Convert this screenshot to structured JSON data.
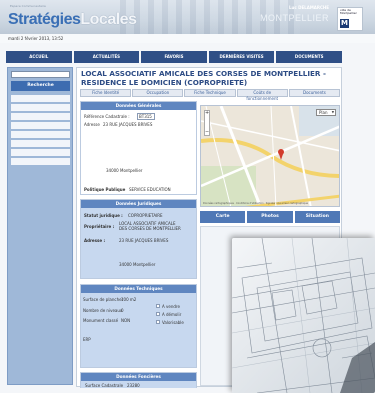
{
  "header": {
    "tiny_text": "Espace Communautaire",
    "logo_part1": "Stratégies",
    "logo_part2": "Locales",
    "user_name": "Luc DELAMARCHE",
    "city": "MONTPELLIER",
    "ville_text": "ville de\nMontpellier",
    "ville_letter": "M"
  },
  "date": "mardi 2 février 2013, 13:52",
  "nav": [
    "Accueil",
    "Actualités",
    "Favoris",
    "Dernières Visites",
    "Documents"
  ],
  "sidebar": {
    "search_button": "Recherche"
  },
  "main": {
    "title": "LOCAL ASSOCIATIF AMICALE DES CORSES DE MONTPELLIER - RESIDENCE LE DOMICIEN (COPROPRIETE)",
    "tabs": [
      "Fiche Identité",
      "Occupation",
      "Fiche Technique",
      "Coûts de fonctionnement",
      "Documents"
    ]
  },
  "general": {
    "header": "Données Générales",
    "ref_label": "Référence Cadastrale :",
    "ref_value": "BT315",
    "address_label": "Adresse",
    "address_value": "23 RUE JACQUES BRIVES",
    "postal": "34000 Montpellier",
    "policy_label": "Politique Publique",
    "policy_value": "SERVICE EDUCATION"
  },
  "juridique": {
    "header": "Données Juridiques",
    "statut_label": "Statut juridique :",
    "statut_value": "COPROPRIETAIRE",
    "owner_label": "Propriétaire :",
    "owner_value": "LOCAL ASSOCIATIF AMICALE DES CORSES DE MONTPELLIER",
    "address_label": "Adresse :",
    "address_value": "23 RUE JACQUES BRIVES",
    "postal": "34000 Montpellier"
  },
  "technique": {
    "header": "Données Techniques",
    "surface_label": "Surface de plancher",
    "surface_value": "100 m2",
    "niveaux_label": "Nombre de niveaux",
    "niveaux_value": "0",
    "monument_label": "Monument classé",
    "monument_value": "NON",
    "opt1": "A vendre",
    "opt2": "A démolir",
    "opt3": "Valorisable",
    "erp": "ERP"
  },
  "foncieres": {
    "header": "Données Foncières",
    "surface_label": "Surface Cadastrale",
    "surface_value": "23280"
  },
  "map": {
    "plan_label": "Plan",
    "footer": "Données cartographiques · Conditions d'utilisation · Signaler une erreur cartographique",
    "buttons": [
      "Carte",
      "Photos",
      "Situation"
    ]
  }
}
